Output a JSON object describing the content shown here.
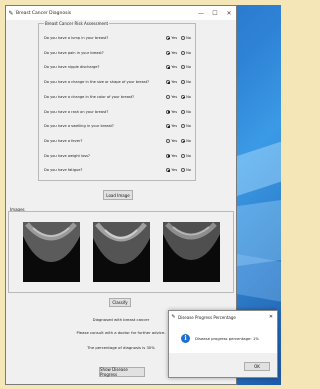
{
  "window": {
    "title": "Breast Cancer Diagnosis",
    "minimize": "—",
    "maximize": "☐",
    "close": "✕"
  },
  "assessment": {
    "legend": "Breast Cancer Risk Assessment",
    "yes_label": "Yes",
    "no_label": "No",
    "questions": [
      {
        "text": "Do you have a lump in your breast?",
        "selected": "yes"
      },
      {
        "text": "Do you have pain in your breast?",
        "selected": "yes"
      },
      {
        "text": "Do you have nipple discharge?",
        "selected": "yes"
      },
      {
        "text": "Do you have a change in the size or shape of your breast?",
        "selected": "yes"
      },
      {
        "text": "Do you have a change in the color of your breast?",
        "selected": "no"
      },
      {
        "text": "Do you have a rash on your breast?",
        "selected": "yes"
      },
      {
        "text": "Do you have a swelling in your breast?",
        "selected": "yes"
      },
      {
        "text": "Do you have a fever?",
        "selected": "no"
      },
      {
        "text": "Do you have weight loss?",
        "selected": "yes"
      },
      {
        "text": "Do you have fatigue?",
        "selected": "yes"
      }
    ]
  },
  "load_button": "Load Image",
  "images_label": "Images",
  "classify_button": "Classify",
  "result": {
    "diagnosis": "Diagnosed with breast cancer",
    "advice": "Please consult with a doctor for further advice.",
    "percentage": "The percentage of diagnosis is 30%"
  },
  "progress_button": "Show Disease Progress",
  "dialog": {
    "title": "Disease Progress Percentage",
    "message": "Disease progress percentage: 1%",
    "ok_button": "OK",
    "close": "✕"
  }
}
